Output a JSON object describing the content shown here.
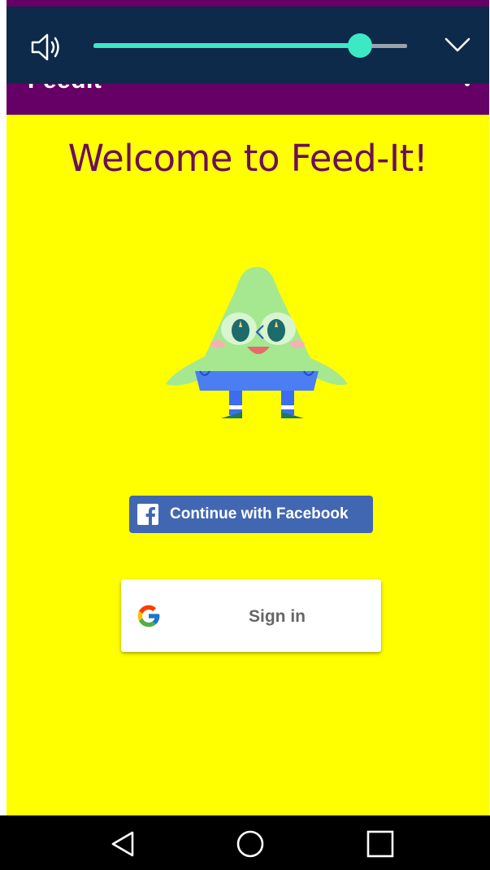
{
  "app": {
    "bar_title": "FeedIt",
    "welcome_text": "Welcome to Feed-It!",
    "background_color": "#ffff00",
    "bar_color": "#660066"
  },
  "login": {
    "facebook_label": "Continue with Facebook",
    "google_label": "Sign in",
    "facebook_color": "#4267b2"
  },
  "volume": {
    "level_fraction": 0.85,
    "accent_color": "#3de8c4",
    "icon": "speaker-icon",
    "collapse_icon": "chevron-down-icon"
  },
  "nav": {
    "back_icon": "back-triangle-icon",
    "home_icon": "home-circle-icon",
    "recents_icon": "recents-square-icon"
  }
}
